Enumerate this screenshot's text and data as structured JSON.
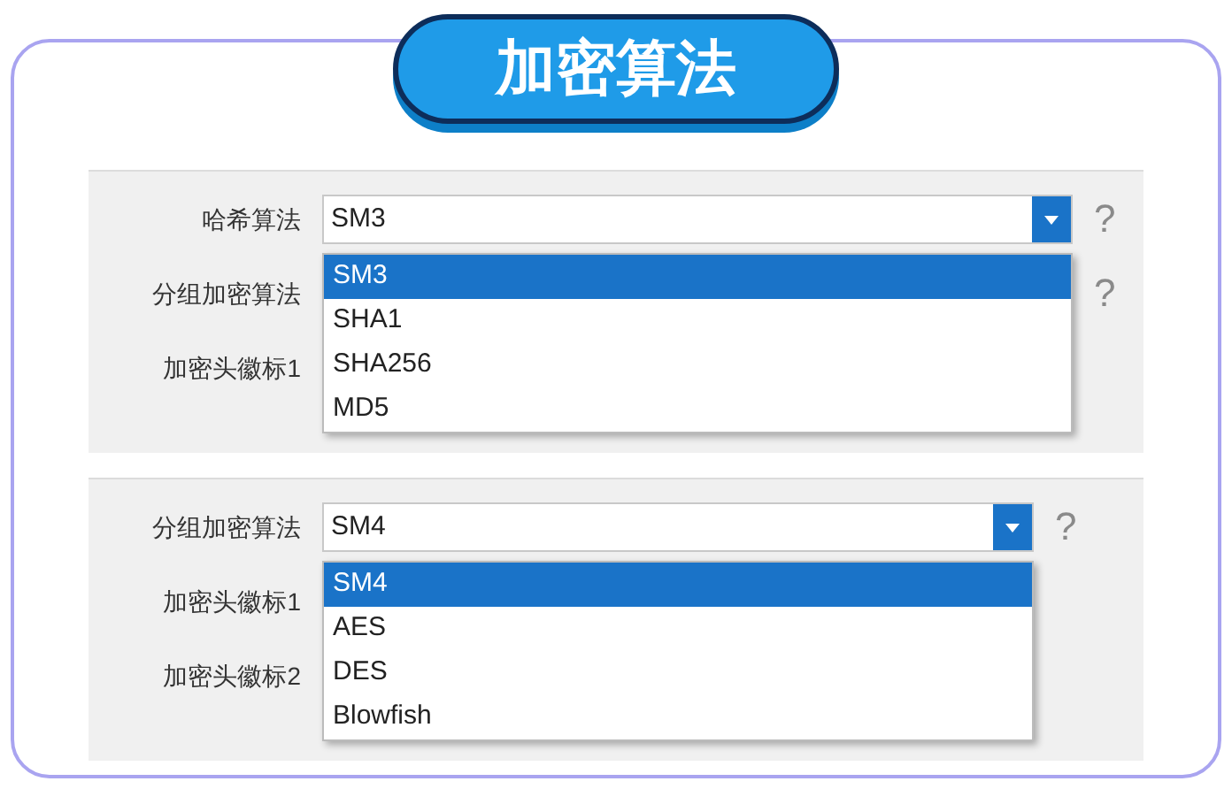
{
  "title": "加密算法",
  "panels": [
    {
      "field": {
        "label": "哈希算法",
        "value": "SM3",
        "help": "?",
        "options": [
          {
            "label": "SM3",
            "selected": true
          },
          {
            "label": "SHA1",
            "selected": false
          },
          {
            "label": "SHA256",
            "selected": false
          },
          {
            "label": "MD5",
            "selected": false
          }
        ]
      },
      "rows": [
        {
          "label": "分组加密算法",
          "help": "?"
        },
        {
          "label": "加密头徽标1"
        }
      ]
    },
    {
      "field": {
        "label": "分组加密算法",
        "value": "SM4",
        "help": "?",
        "options": [
          {
            "label": "SM4",
            "selected": true
          },
          {
            "label": "AES",
            "selected": false
          },
          {
            "label": "DES",
            "selected": false
          },
          {
            "label": "Blowfish",
            "selected": false
          }
        ]
      },
      "rows": [
        {
          "label": "加密头徽标1"
        },
        {
          "label": "加密头徽标2"
        }
      ]
    }
  ]
}
